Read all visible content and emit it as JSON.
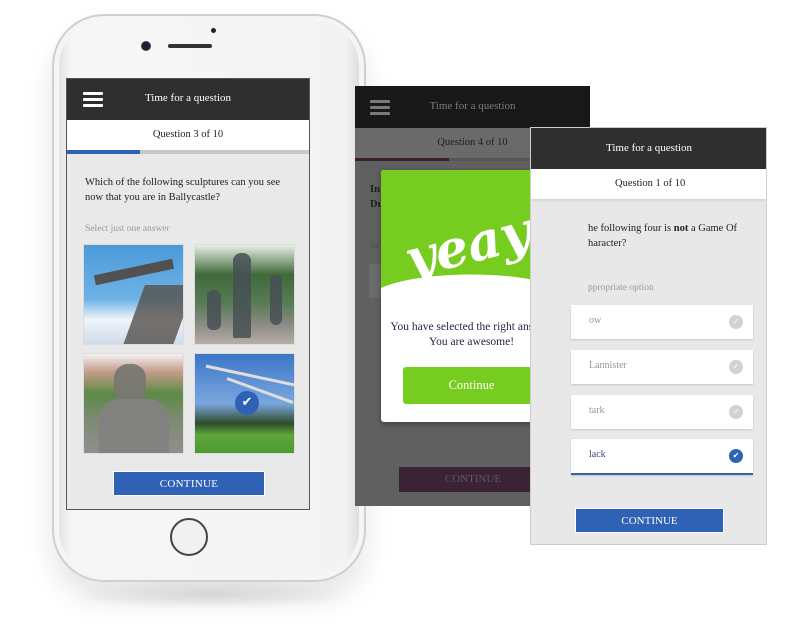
{
  "colors": {
    "accent_blue": "#2f62b5",
    "topbar_dark": "#2f2f2f",
    "success_green": "#77cd1f",
    "screen_bg": "#e9e9e9"
  },
  "phone_screen": {
    "header_title": "Time for a question",
    "menu_icon": "hamburger-menu-icon",
    "question_counter": "Question 3 of 10",
    "progress_fraction": 0.3,
    "question_text": "Which of the following sculptures can you see now that you are in Ballycastle?",
    "hint": "Select just one answer",
    "answers": [
      {
        "image": "winged-figure-sculpture",
        "selected": false
      },
      {
        "image": "children-group-statue",
        "selected": false
      },
      {
        "image": "man-bust-statue",
        "selected": false
      },
      {
        "image": "flying-swans-sculpture",
        "selected": true
      }
    ],
    "selected_icon": "check-icon",
    "continue_label": "CONTINUE"
  },
  "middle_screen": {
    "header_title": "Time for a question",
    "question_counter": "Question 4 of 10",
    "progress_fraction": 0.4,
    "question_fragment_line1": "In",
    "question_fragment_line2": "Du",
    "hint_fragment": "Se",
    "continue_label": "CONTINUE",
    "modal": {
      "hero_text": "yeay!",
      "message": "You have selected the right answer. You are awesome!",
      "button_label": "Continue",
      "close_icon": "close-icon"
    }
  },
  "right_screen": {
    "header_title": "Time for a question",
    "question_counter": "Question 1 of 10",
    "question_text_before_bold": "he following four is ",
    "question_text_bold": "not",
    "question_text_after_bold": " a Game Of",
    "question_text_line2": "haracter?",
    "hint": "ppropriate option",
    "options": [
      {
        "label": "ow",
        "selected": false
      },
      {
        "label": "Lannister",
        "selected": false
      },
      {
        "label": "tark",
        "selected": false
      },
      {
        "label": "lack",
        "selected": true
      }
    ],
    "continue_label": "CONTINUE"
  }
}
